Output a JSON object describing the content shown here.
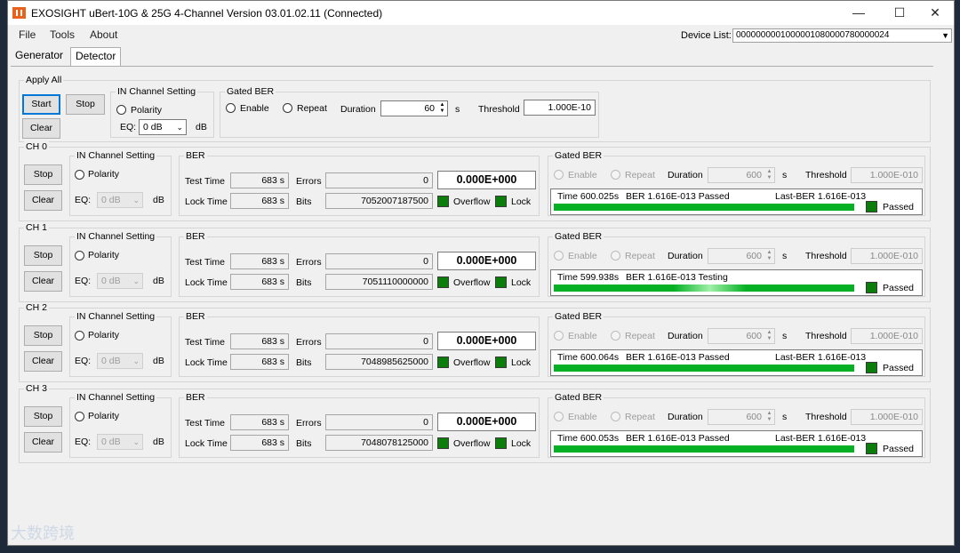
{
  "window": {
    "title": "EXOSIGHT uBert-10G & 25G 4-Channel Version 03.01.02.11   (Connected)",
    "buttons": {
      "minimize": "—",
      "maximize": "☐",
      "close": "✕"
    }
  },
  "menu": [
    "File",
    "Tools",
    "About"
  ],
  "device_list": {
    "label": "Device List:",
    "value": "0000000001000001080000780000024"
  },
  "tabs": [
    "Generator",
    "Detector"
  ],
  "apply_all": {
    "title": "Apply All",
    "start": "Start",
    "stop": "Stop",
    "clear": "Clear",
    "in_channel_title": "IN Channel Setting",
    "polarity": "Polarity",
    "eq_label": "EQ:",
    "eq_value": "0 dB",
    "eq_unit": "dB",
    "gated_title": "Gated BER",
    "enable": "Enable",
    "repeat": "Repeat",
    "duration_label": "Duration",
    "duration_value": "60",
    "duration_unit": "s",
    "threshold_label": "Threshold",
    "threshold_value": "1.000E-10"
  },
  "labels": {
    "stop": "Stop",
    "clear": "Clear",
    "in_channel": "IN Channel Setting",
    "polarity": "Polarity",
    "eq": "EQ:",
    "db": "dB",
    "ber": "BER",
    "test_time": "Test Time",
    "lock_time": "Lock Time",
    "errors": "Errors",
    "bits": "Bits",
    "overflow": "Overflow",
    "lock": "Lock",
    "gated_ber": "Gated BER",
    "enable": "Enable",
    "repeat": "Repeat",
    "duration": "Duration",
    "s": "s",
    "threshold": "Threshold",
    "passed": "Passed"
  },
  "channels": [
    {
      "name": "CH 0",
      "eq": "0 dB",
      "test_time": "683 s",
      "lock_time": "683 s",
      "errors": "0",
      "bits": "7052007187500",
      "ber": "0.000E+000",
      "duration": "600",
      "threshold": "1.000E-010",
      "time": "Time  600.025s",
      "ber_status": "BER  1.616E-013  Passed",
      "last_ber": "Last-BER 1.616E-013",
      "status": "Passed"
    },
    {
      "name": "CH 1",
      "eq": "0 dB",
      "test_time": "683 s",
      "lock_time": "683 s",
      "errors": "0",
      "bits": "7051110000000",
      "ber": "0.000E+000",
      "duration": "600",
      "threshold": "1.000E-010",
      "time": "Time  599.938s",
      "ber_status": "BER  1.616E-013  Testing",
      "last_ber": "",
      "status": "Passed"
    },
    {
      "name": "CH 2",
      "eq": "0 dB",
      "test_time": "683 s",
      "lock_time": "683 s",
      "errors": "0",
      "bits": "7048985625000",
      "ber": "0.000E+000",
      "duration": "600",
      "threshold": "1.000E-010",
      "time": "Time  600.064s",
      "ber_status": "BER  1.616E-013  Passed",
      "last_ber": "Last-BER 1.616E-013",
      "status": "Passed"
    },
    {
      "name": "CH 3",
      "eq": "0 dB",
      "test_time": "683 s",
      "lock_time": "683 s",
      "errors": "0",
      "bits": "7048078125000",
      "ber": "0.000E+000",
      "duration": "600",
      "threshold": "1.000E-010",
      "time": "Time  600.053s",
      "ber_status": "BER  1.616E-013  Passed",
      "last_ber": "Last-BER 1.616E-013",
      "status": "Passed"
    }
  ],
  "watermark": "大数跨境",
  "colors": {
    "led": "#0b7d0b",
    "progress": "#06b025",
    "accent": "#0078d7"
  }
}
